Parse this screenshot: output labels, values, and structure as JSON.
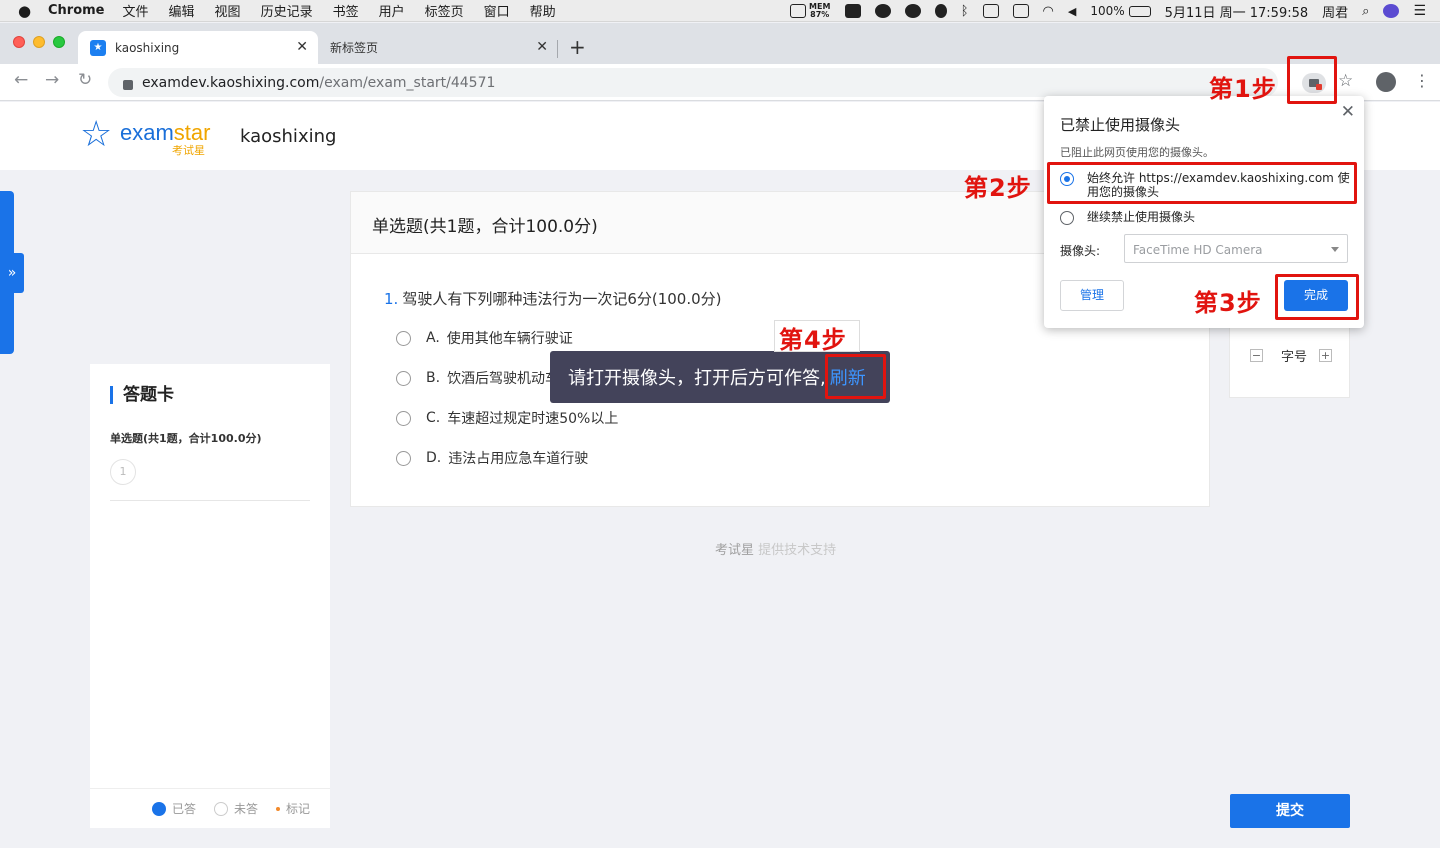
{
  "menubar": {
    "apple": "",
    "app_name": "Chrome",
    "menus": [
      "文件",
      "编辑",
      "视图",
      "历史记录",
      "书签",
      "用户",
      "标签页",
      "窗口",
      "帮助"
    ],
    "status": {
      "mem_label": "MEM",
      "mem_value": "87%",
      "battery": "100%",
      "clock": "5月11日 周一  17:59:58",
      "user": "周君"
    }
  },
  "tabs": [
    {
      "label": "kaoshixing",
      "close": "✕"
    },
    {
      "label": "新标签页",
      "close": "✕"
    }
  ],
  "new_tab": "+",
  "omnibox": {
    "host": "examdev.kaoshixing.com",
    "path": "/exam/exam_start/44571"
  },
  "header": {
    "logo_exam": "exam",
    "logo_star": "star",
    "logo_sub": "考试星",
    "site_name": "kaoshixing"
  },
  "answer_card": {
    "title": "答题卡",
    "section": "单选题(共1题，合计100.0分)",
    "numbers": [
      "1"
    ],
    "legend": {
      "answered": "已答",
      "unanswered": "未答",
      "marked": "标记"
    }
  },
  "question_panel": {
    "heading": "单选题(共1题，合计100.0分)",
    "question_number": "1.",
    "question_text": "驾驶人有下列哪种违法行为一次记6分(100.0分)",
    "options": [
      {
        "letter": "A.",
        "text": "使用其他车辆行驶证"
      },
      {
        "letter": "B.",
        "text": "饮酒后驾驶机动车"
      },
      {
        "letter": "C.",
        "text": "车速超过规定时速50%以上"
      },
      {
        "letter": "D.",
        "text": "违法占用应急车道行驶"
      }
    ]
  },
  "powered_by": {
    "brand": "考试星",
    "text": "提供技术支持"
  },
  "font_size": {
    "minus": "−",
    "label": "字号",
    "plus": "+"
  },
  "submit": "提交",
  "camera_toast": {
    "message": "请打开摄像头，打开后方可作答,",
    "refresh": "刷新"
  },
  "camera_popup": {
    "title": "已禁止使用摄像头",
    "subtitle": "已阻止此网页使用您的摄像头。",
    "option_allow": "始终允许 https://examdev.kaoshixing.com 使用您的摄像头",
    "option_block": "继续禁止使用摄像头",
    "camera_label": "摄像头:",
    "camera_value": "FaceTime HD Camera",
    "manage": "管理",
    "done": "完成",
    "close": "✕"
  },
  "annotations": {
    "step1": "第1步",
    "step2": "第2步",
    "step3": "第3步",
    "step4": "第4步",
    "color": "#e1140f"
  }
}
